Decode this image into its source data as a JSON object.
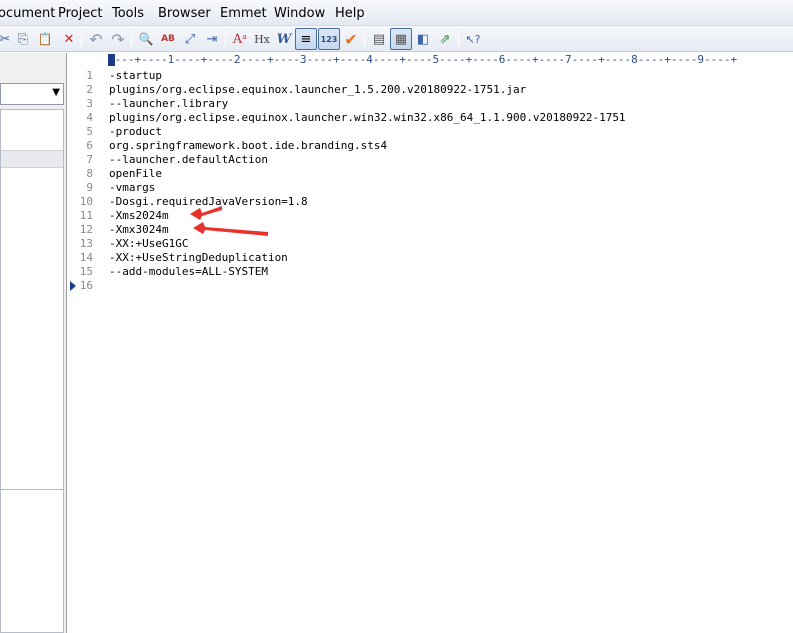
{
  "menu": {
    "items": [
      "ocument",
      "Project",
      "Tools",
      "Browser",
      "Emmet",
      "Window",
      "Help"
    ]
  },
  "toolbar": {
    "icons": [
      "cut-icon",
      "copy-icon",
      "paste-icon",
      "delete-icon",
      "undo-icon",
      "redo-icon",
      "find-icon",
      "replace-icon",
      "find-in-files-icon",
      "goto-line-icon",
      "spell-check-icon",
      "html-toolbar-icon",
      "word-wrap-icon",
      "indent-icon",
      "line-numbers-icon",
      "checkmark-icon",
      "view-list-icon",
      "view-split-icon",
      "browser-preview-icon",
      "open-browser-icon",
      "pointer-help-icon"
    ],
    "glyphs": [
      "✂",
      "⎘",
      "📋",
      "✕",
      "↶",
      "↷",
      "🔍",
      "AB",
      "⤢",
      "⇥",
      "Aᵃ",
      "Hx",
      "W",
      "≡",
      "123",
      "✔",
      "▤",
      "▦",
      "◧",
      "⇗",
      "↖?"
    ]
  },
  "ruler": {
    "text": "----+----1----+----2----+----3----+----4----+----5----+----6----+----7----+----8----+----9----+"
  },
  "editor": {
    "lines": [
      {
        "num": "1",
        "text": "-startup"
      },
      {
        "num": "2",
        "text": "plugins/org.eclipse.equinox.launcher_1.5.200.v20180922-1751.jar"
      },
      {
        "num": "3",
        "text": "--launcher.library"
      },
      {
        "num": "4",
        "text": "plugins/org.eclipse.equinox.launcher.win32.win32.x86_64_1.1.900.v20180922-1751"
      },
      {
        "num": "5",
        "text": "-product"
      },
      {
        "num": "6",
        "text": "org.springframework.boot.ide.branding.sts4"
      },
      {
        "num": "7",
        "text": "--launcher.defaultAction"
      },
      {
        "num": "8",
        "text": "openFile"
      },
      {
        "num": "9",
        "text": "-vmargs"
      },
      {
        "num": "10",
        "text": "-Dosgi.requiredJavaVersion=1.8"
      },
      {
        "num": "11",
        "text": "-Xms2024m"
      },
      {
        "num": "12",
        "text": "-Xmx3024m"
      },
      {
        "num": "13",
        "text": "-XX:+UseG1GC"
      },
      {
        "num": "14",
        "text": "-XX:+UseStringDeduplication"
      },
      {
        "num": "15",
        "text": "--add-modules=ALL-SYSTEM"
      },
      {
        "num": "16",
        "text": ""
      }
    ],
    "current_line": 16
  },
  "annotations": {
    "arrow_color": "#e8312b",
    "arrows_point_to_lines": [
      11,
      12
    ]
  }
}
